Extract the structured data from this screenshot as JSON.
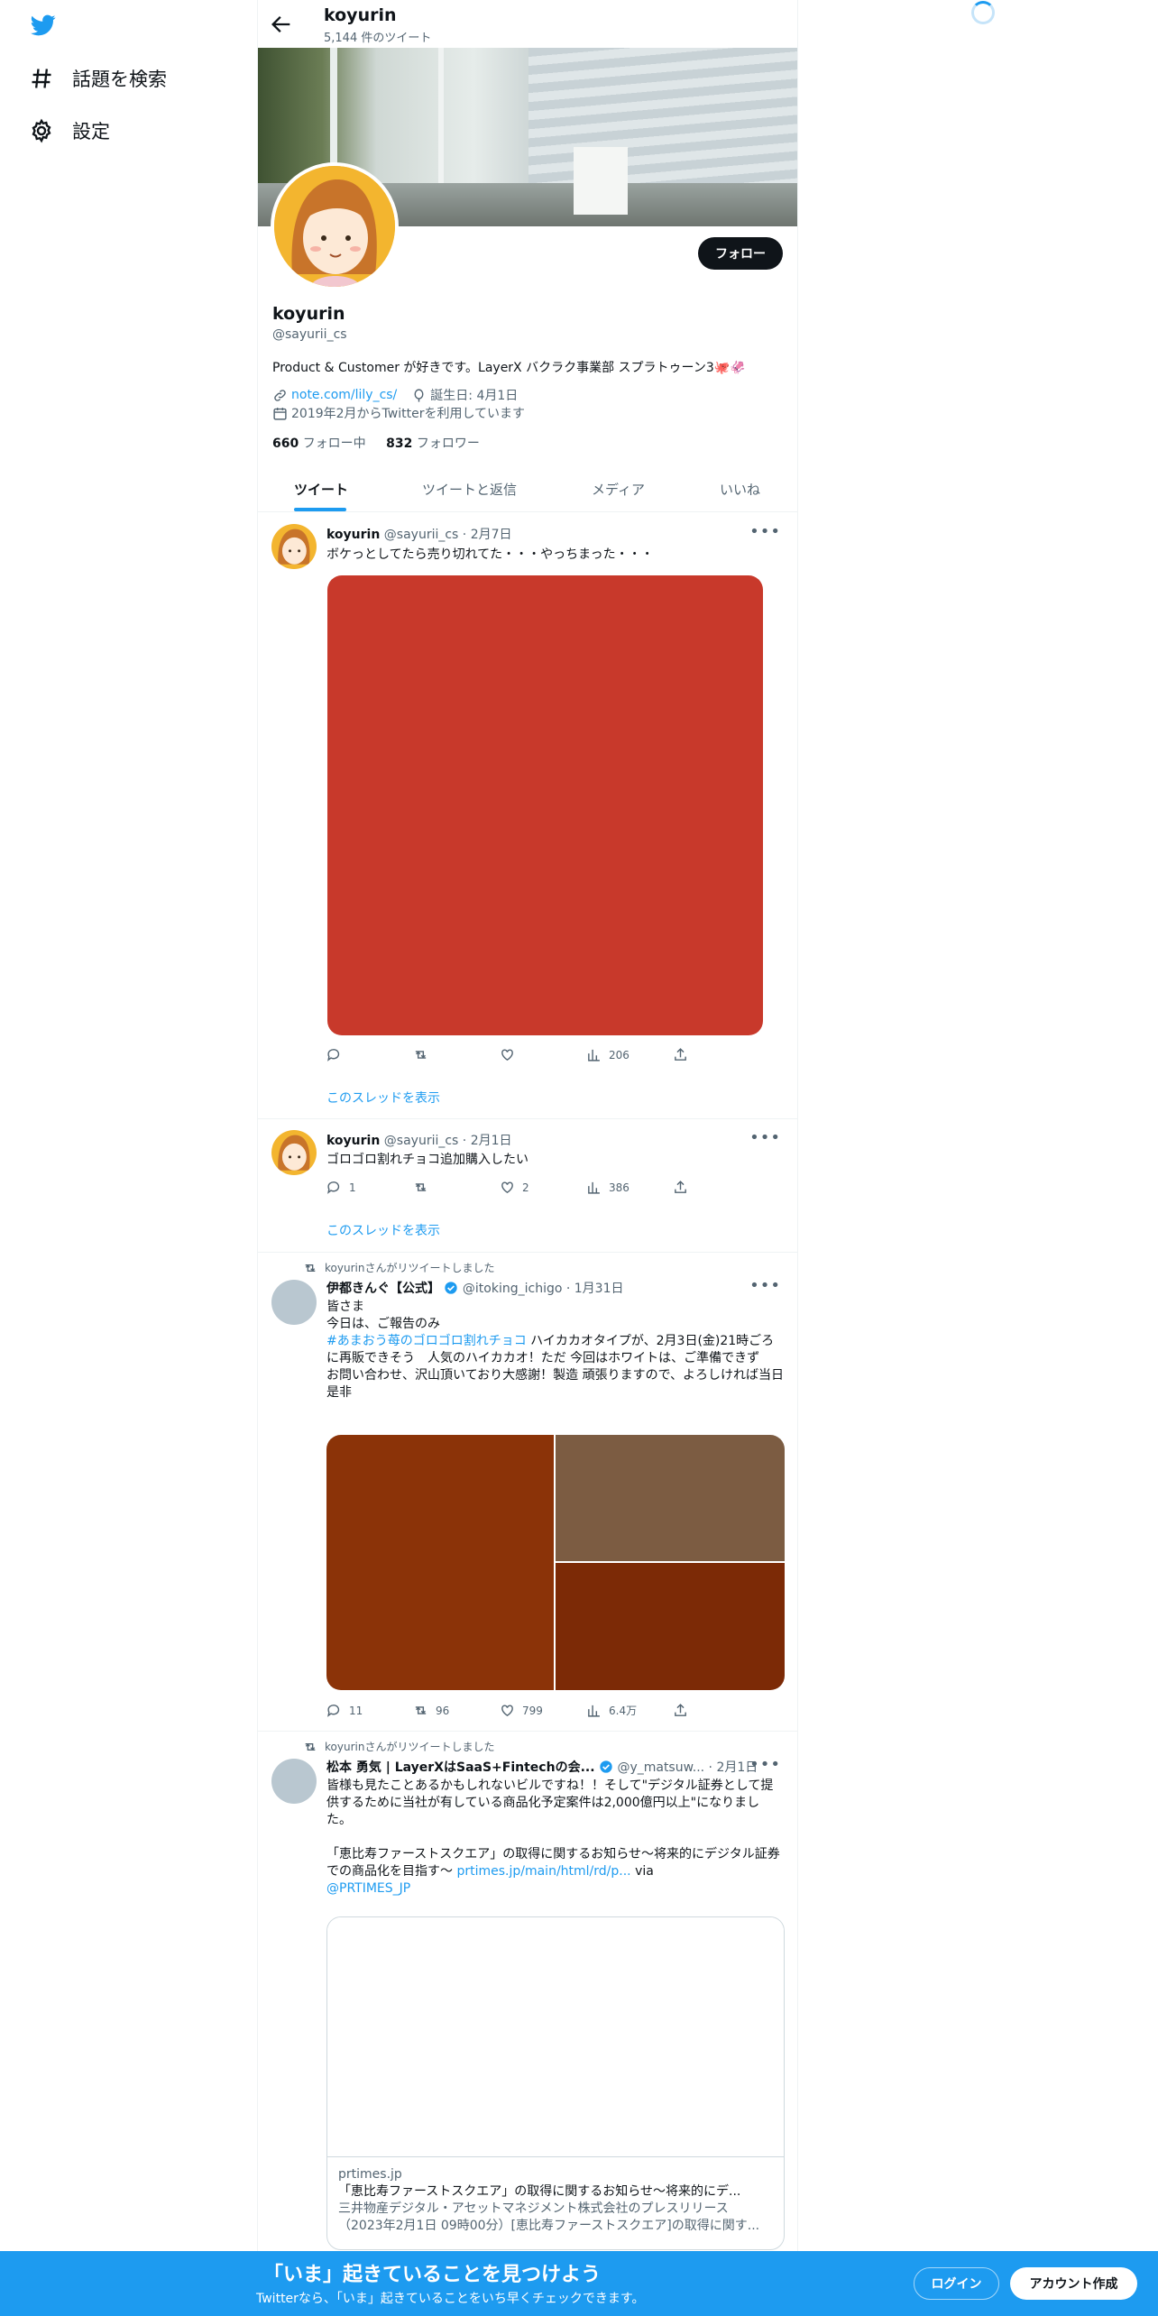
{
  "sidebar": {
    "items": [
      {
        "label": "話題を検索",
        "icon": "hashtag-icon"
      },
      {
        "label": "設定",
        "icon": "gear-icon"
      }
    ]
  },
  "header": {
    "name": "koyurin",
    "tweet_count": "5,144 件のツイート"
  },
  "profile": {
    "follow_label": "フォロー",
    "name": "koyurin",
    "handle": "@sayurii_cs",
    "bio": "Product & Customer が好きです。LayerX バクラク事業部 スプラトゥーン3🐙🦑",
    "link": "note.com/lily_cs/",
    "birthday": "誕生日: 4月1日",
    "joined": "2019年2月からTwitterを利用しています",
    "following_count": "660",
    "following_label": "フォロー中",
    "followers_count": "832",
    "followers_label": "フォロワー"
  },
  "tabs": [
    "ツイート",
    "ツイートと返信",
    "メディア",
    "いいね"
  ],
  "tweets": [
    {
      "name": "koyurin",
      "meta": "@sayurii_cs · 2月7日",
      "text": "ボケっとしてたら売り切れてた・・・やっちまった・・・",
      "media_color": "#c8392b",
      "views": "206",
      "thread": "このスレッドを表示"
    },
    {
      "name": "koyurin",
      "meta": "@sayurii_cs · 2月1日",
      "text": "ゴロゴロ割れチョコ追加購入したい",
      "replies": "1",
      "likes": "2",
      "views": "386",
      "thread": "このスレッドを表示"
    },
    {
      "retweet_by": "koyurinさんがリツイートしました",
      "name": "伊都きんぐ【公式】",
      "meta": "@itoking_ichigo · 1月31日",
      "text_1": "皆さま",
      "text_2": "今日は、ご報告のみ",
      "hashtag": "#あまおう苺のゴロゴロ割れチョコ",
      "text_3": " ハイカカオタイプが、2月3日(金)21時ごろに再販できそう　人気のハイカカオ！ただ 今回はホワイトは、ご準備できず",
      "text_4": "お問い合わせ、沢山頂いており大感謝！製造 頑張りますので、よろしければ当日是非",
      "media_colors": [
        "#8b3308",
        "#7c5c42",
        "#7c2a06"
      ],
      "replies": "11",
      "retweets": "96",
      "likes": "799",
      "views": "6.4万"
    },
    {
      "retweet_by": "koyurinさんがリツイートしました",
      "name": "松本 勇気 | LayerXはSaaS+Fintechの会...",
      "meta": "@y_matsuw... · 2月1日",
      "text_1": "皆様も見たことあるかもしれないビルですね！！そして\"デジタル証券として提供するために当社が有している商品化予定案件は2,000億円以上\"になりました。",
      "text_2": "「恵比寿ファーストスクエア」の取得に関するお知らせ〜将来的にデジタル証券での商品化を目指す〜 ",
      "link": "prtimes.jp/main/html/rd/p...",
      "via": " via",
      "mention": "@PRTIMES_JP",
      "card_domain": "prtimes.jp",
      "card_title": "「恵比寿ファーストスクエア」の取得に関するお知らせ〜将来的にデ...",
      "card_desc": "三井物産デジタル・アセットマネジメント株式会社のプレスリリース（2023年2月1日 09時00分）[恵比寿ファーストスクエア]の取得に関す..."
    }
  ],
  "bottom_bar": {
    "title": "「いま」起きていることを見つけよう",
    "subtitle": "Twitterなら、「いま」起きていることをいち早くチェックできます。",
    "login": "ログイン",
    "signup": "アカウント作成"
  },
  "colors": {
    "accent": "#1d9bf0",
    "text": "#0f1419",
    "muted": "#536471"
  }
}
